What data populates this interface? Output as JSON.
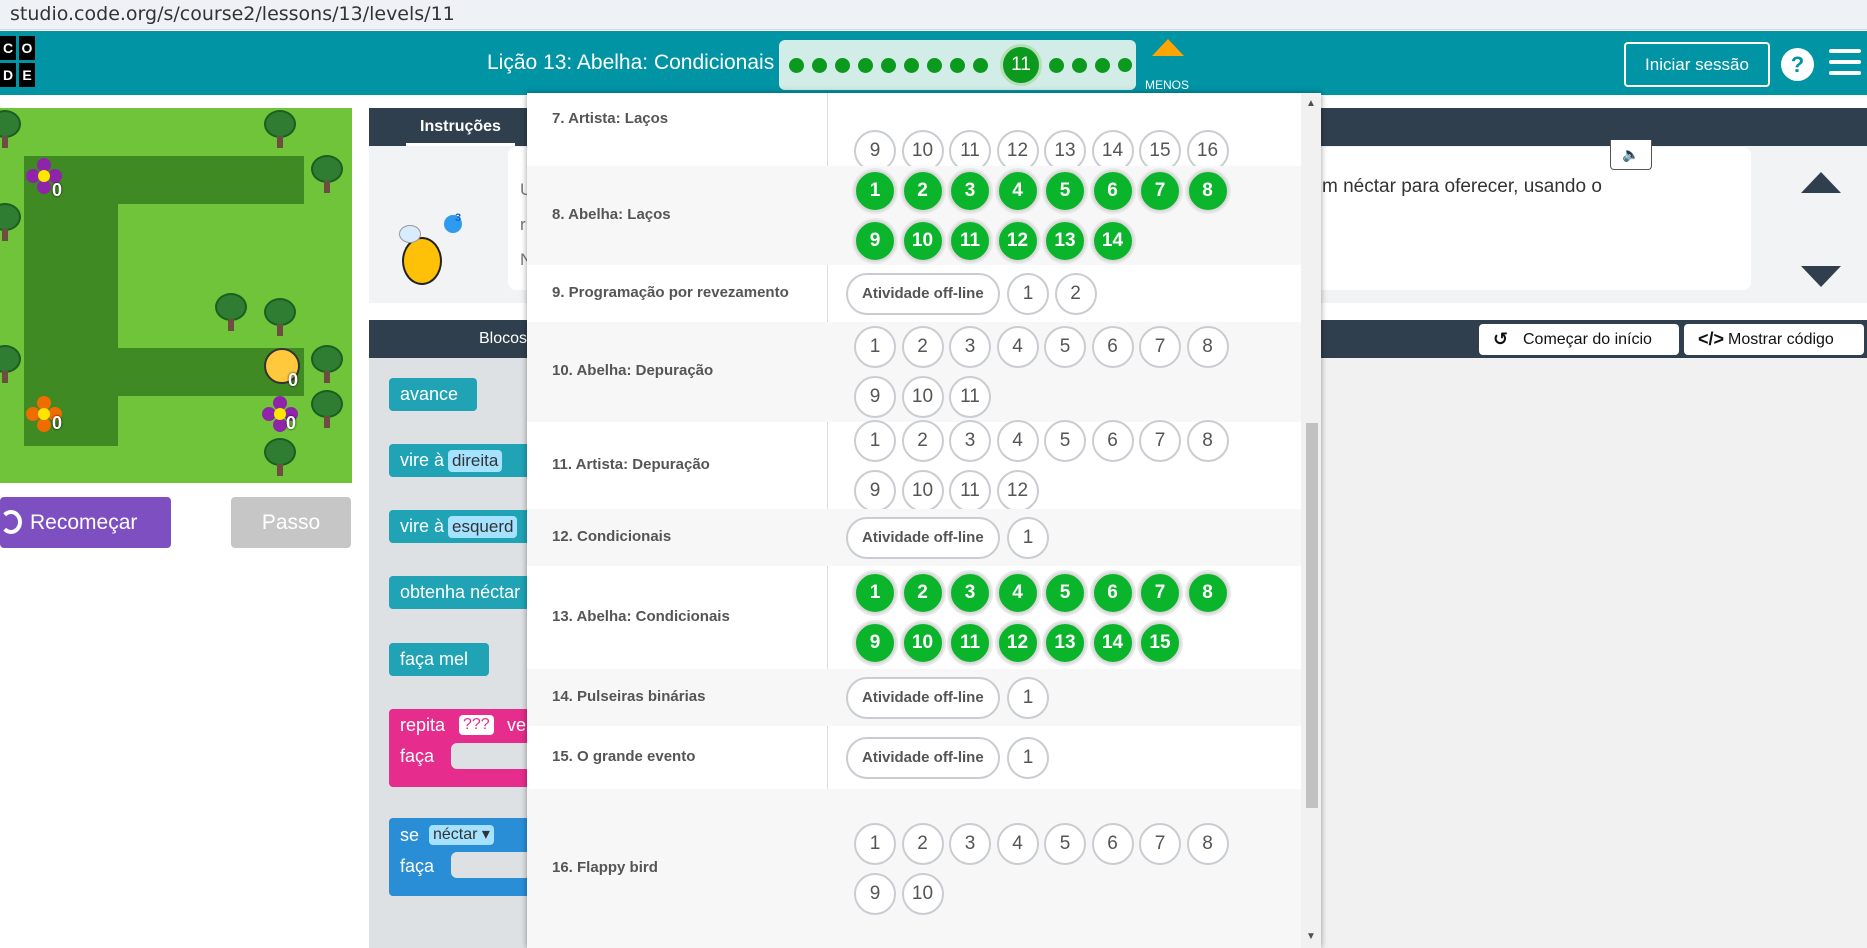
{
  "browser": {
    "url": "studio.code.org/s/course2/lessons/13/levels/11"
  },
  "header": {
    "logo_letters": [
      "C",
      "O",
      "D",
      "E"
    ],
    "lesson_title": "Lição 13: Abelha: Condicionais",
    "current_level": "11",
    "less_label": "MENOS",
    "signin_label": "Iniciar sessão",
    "help_label": "?"
  },
  "game": {
    "restart_label": "Recomeçar",
    "step_label": "Passo",
    "counts": [
      "0",
      "0",
      "0",
      "0"
    ]
  },
  "instructions": {
    "tab_label": "Instruções",
    "text": "m néctar para oferecer, usando o",
    "hint_count": "3",
    "lead_letters": [
      "U",
      "r",
      "N"
    ]
  },
  "workspace": {
    "toolbox_label": "Blocos",
    "start_over_label": "Começar do início",
    "show_code_label": "Mostrar código"
  },
  "blocks": {
    "forward": "avance",
    "turn_right": "vire à",
    "right_field": "direita",
    "turn_left": "vire à",
    "left_field": "esquerd",
    "get_nectar": "obtenha néctar",
    "make_honey": "faça mel",
    "repeat": "repita",
    "repeat_field": "???",
    "repeat_suffix": "ve",
    "do": "faça",
    "if": "se",
    "if_field": "néctar ▾",
    "if_do": "faça"
  },
  "lessons": [
    {
      "name": "7. Artista: Laços",
      "offline": null,
      "levels": [
        "9",
        "10",
        "11",
        "12",
        "13",
        "14",
        "15",
        "16"
      ],
      "done": []
    },
    {
      "name": "8. Abelha: Laços",
      "offline": null,
      "levels": [
        "1",
        "2",
        "3",
        "4",
        "5",
        "6",
        "7",
        "8",
        "9",
        "10",
        "11",
        "12",
        "13",
        "14"
      ],
      "done": [
        "1",
        "2",
        "3",
        "4",
        "5",
        "6",
        "7",
        "8",
        "9",
        "10",
        "11",
        "12",
        "13",
        "14"
      ]
    },
    {
      "name": "9. Programação por revezamento",
      "offline": "Atividade off-line",
      "levels": [
        "1",
        "2"
      ],
      "done": []
    },
    {
      "name": "10. Abelha: Depuração",
      "offline": null,
      "levels": [
        "1",
        "2",
        "3",
        "4",
        "5",
        "6",
        "7",
        "8",
        "9",
        "10",
        "11"
      ],
      "done": []
    },
    {
      "name": "11. Artista: Depuração",
      "offline": null,
      "levels": [
        "1",
        "2",
        "3",
        "4",
        "5",
        "6",
        "7",
        "8",
        "9",
        "10",
        "11",
        "12"
      ],
      "done": []
    },
    {
      "name": "12. Condicionais",
      "offline": "Atividade off-line",
      "levels": [
        "1"
      ],
      "done": []
    },
    {
      "name": "13. Abelha: Condicionais",
      "offline": null,
      "levels": [
        "1",
        "2",
        "3",
        "4",
        "5",
        "6",
        "7",
        "8",
        "9",
        "10",
        "11",
        "12",
        "13",
        "14",
        "15"
      ],
      "done": [
        "1",
        "2",
        "3",
        "4",
        "5",
        "6",
        "7",
        "8",
        "9",
        "10",
        "11",
        "12",
        "13",
        "14",
        "15"
      ]
    },
    {
      "name": "14. Pulseiras binárias",
      "offline": "Atividade off-line",
      "levels": [
        "1"
      ],
      "done": []
    },
    {
      "name": "15. O grande evento",
      "offline": "Atividade off-line",
      "levels": [
        "1"
      ],
      "done": []
    },
    {
      "name": "16. Flappy bird",
      "offline": null,
      "levels": [
        "1",
        "2",
        "3",
        "4",
        "5",
        "6",
        "7",
        "8",
        "9",
        "10"
      ],
      "done": []
    }
  ],
  "colors": {
    "header": "#0094a5",
    "done": "#0bb52b",
    "restart": "#7e4fc0",
    "menos": "#ffa400"
  }
}
